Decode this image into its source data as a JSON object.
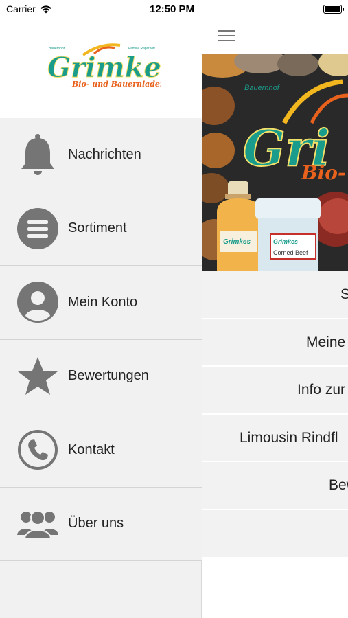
{
  "status_bar": {
    "carrier": "Carrier",
    "time": "12:50 PM"
  },
  "drawer": {
    "logo": {
      "small_left": "Bauernhof",
      "small_right": "Familie Rapsthoff",
      "brand": "Grimkes",
      "tagline": "Bio- und Bauernladen"
    },
    "items": [
      {
        "label": "Nachrichten",
        "icon": "bell-icon"
      },
      {
        "label": "Sortiment",
        "icon": "list-icon"
      },
      {
        "label": "Mein Konto",
        "icon": "user-icon"
      },
      {
        "label": "Bewertungen",
        "icon": "star-icon"
      },
      {
        "label": "Kontakt",
        "icon": "phone-icon"
      },
      {
        "label": "Über uns",
        "icon": "group-icon"
      }
    ]
  },
  "main": {
    "hero": {
      "small_text": "Bauernhof",
      "brand": "Gri",
      "tagline": "Bio- u",
      "jar_brand": "Grimkes",
      "jar_label": "Corned Beef",
      "bottle_brand": "Grimkes"
    },
    "items": [
      {
        "label": "S"
      },
      {
        "label": "Meine"
      },
      {
        "label": "Info zur"
      },
      {
        "label": "Limousin Rindfl"
      },
      {
        "label": "Bew"
      },
      {
        "label": ""
      }
    ]
  },
  "colors": {
    "brand_teal": "#1a9c8c",
    "brand_orange": "#e8621e",
    "brand_yellow": "#f2b61f",
    "icon_gray": "#757575",
    "drawer_bg": "#f1f1f1"
  }
}
